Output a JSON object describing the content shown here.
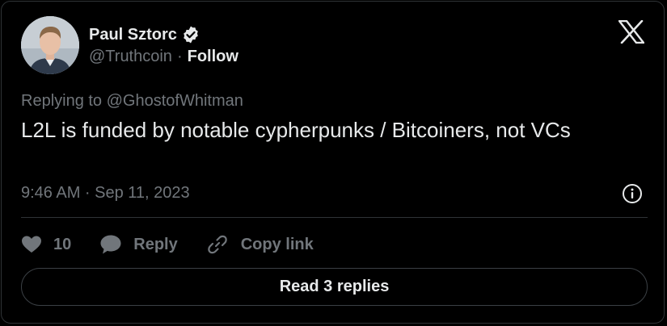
{
  "author": {
    "name": "Paul Sztorc",
    "handle": "@Truthcoin",
    "separator": "·",
    "follow_label": "Follow"
  },
  "tweet": {
    "replying_to": "Replying to @GhostofWhitman",
    "text": "L2L is funded by notable cypherpunks / Bitcoiners, not VCs",
    "timestamp": "9:46 AM · Sep 11, 2023"
  },
  "actions": {
    "like_count": "10",
    "reply_label": "Reply",
    "copy_link_label": "Copy link"
  },
  "read_replies_label": "Read 3 replies",
  "icons": {
    "logo": "x-logo-icon",
    "verified": "verified-badge-icon",
    "info": "info-icon",
    "like": "heart-icon",
    "reply": "comment-bubble-icon",
    "copy": "link-icon"
  },
  "colors": {
    "background": "#000000",
    "text_primary": "#e7e9ea",
    "text_secondary": "#71767b",
    "border": "#2f3336"
  }
}
